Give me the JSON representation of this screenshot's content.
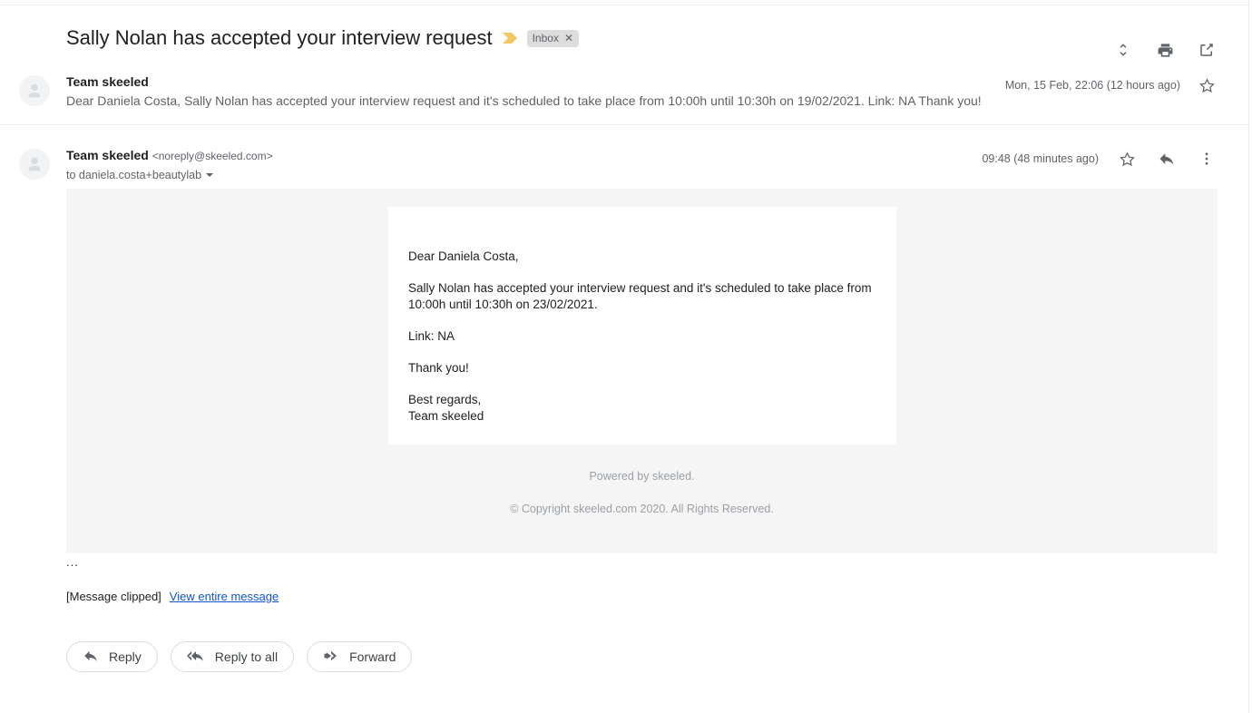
{
  "subject": {
    "text": "Sally Nolan has accepted your interview request",
    "important_marker_icon": "important-marker-icon",
    "label": "Inbox",
    "label_remove_icon": "close-icon"
  },
  "subject_actions": [
    {
      "name": "expand-collapse-button",
      "icon": "unfold-more-icon"
    },
    {
      "name": "print-button",
      "icon": "printer-icon"
    },
    {
      "name": "open-in-new-window-button",
      "icon": "open-in-new-icon"
    }
  ],
  "collapsed_message": {
    "avatar_icon": "person-avatar-icon",
    "sender": "Team skeeled",
    "snippet": "Dear Daniela Costa, Sally Nolan has accepted your interview request and it's scheduled to take place from 10:00h until 10:30h on 19/02/2021. Link: NA Thank you!",
    "date": "Mon, 15 Feb, 22:06 (12 hours ago)",
    "star_icon": "star-outline-icon"
  },
  "expanded_message": {
    "avatar_icon": "person-avatar-icon",
    "sender": "Team skeeled",
    "sender_email": "<noreply@skeeled.com>",
    "to": "to daniela.costa+beautylab",
    "recipient_caret_icon": "chevron-down-icon",
    "date": "09:48 (48 minutes ago)",
    "star_icon": "star-outline-icon",
    "reply_icon": "reply-arrow-icon",
    "more_icon": "more-vertical-icon"
  },
  "email_content": {
    "greeting": "Dear Daniela Costa,",
    "paragraph": "Sally Nolan has accepted your interview request and it's scheduled to take place from 10:00h until 10:30h on 23/02/2021.",
    "link_line": "Link: NA",
    "thanks": "Thank you!",
    "signoff": "Best regards,\nTeam skeeled",
    "powered_by": "Powered by skeeled.",
    "copyright": "© Copyright skeeled.com 2020. All Rights Reserved."
  },
  "clipped": {
    "ellipsis": "...",
    "notice": "[Message clipped]",
    "link": "View entire message"
  },
  "actions": [
    {
      "name": "reply-button",
      "label": "Reply",
      "icon": "reply-arrow-icon"
    },
    {
      "name": "reply-all-button",
      "label": "Reply to all",
      "icon": "reply-all-arrow-icon"
    },
    {
      "name": "forward-button",
      "label": "Forward",
      "icon": "forward-arrow-icon"
    }
  ],
  "colors": {
    "important_marker": "#f2c960",
    "label_chip_bg": "#dddddd",
    "body_backdrop": "#f5f5f5",
    "link": "#1155cc",
    "text_primary": "#202124",
    "text_secondary": "#5f6368"
  }
}
